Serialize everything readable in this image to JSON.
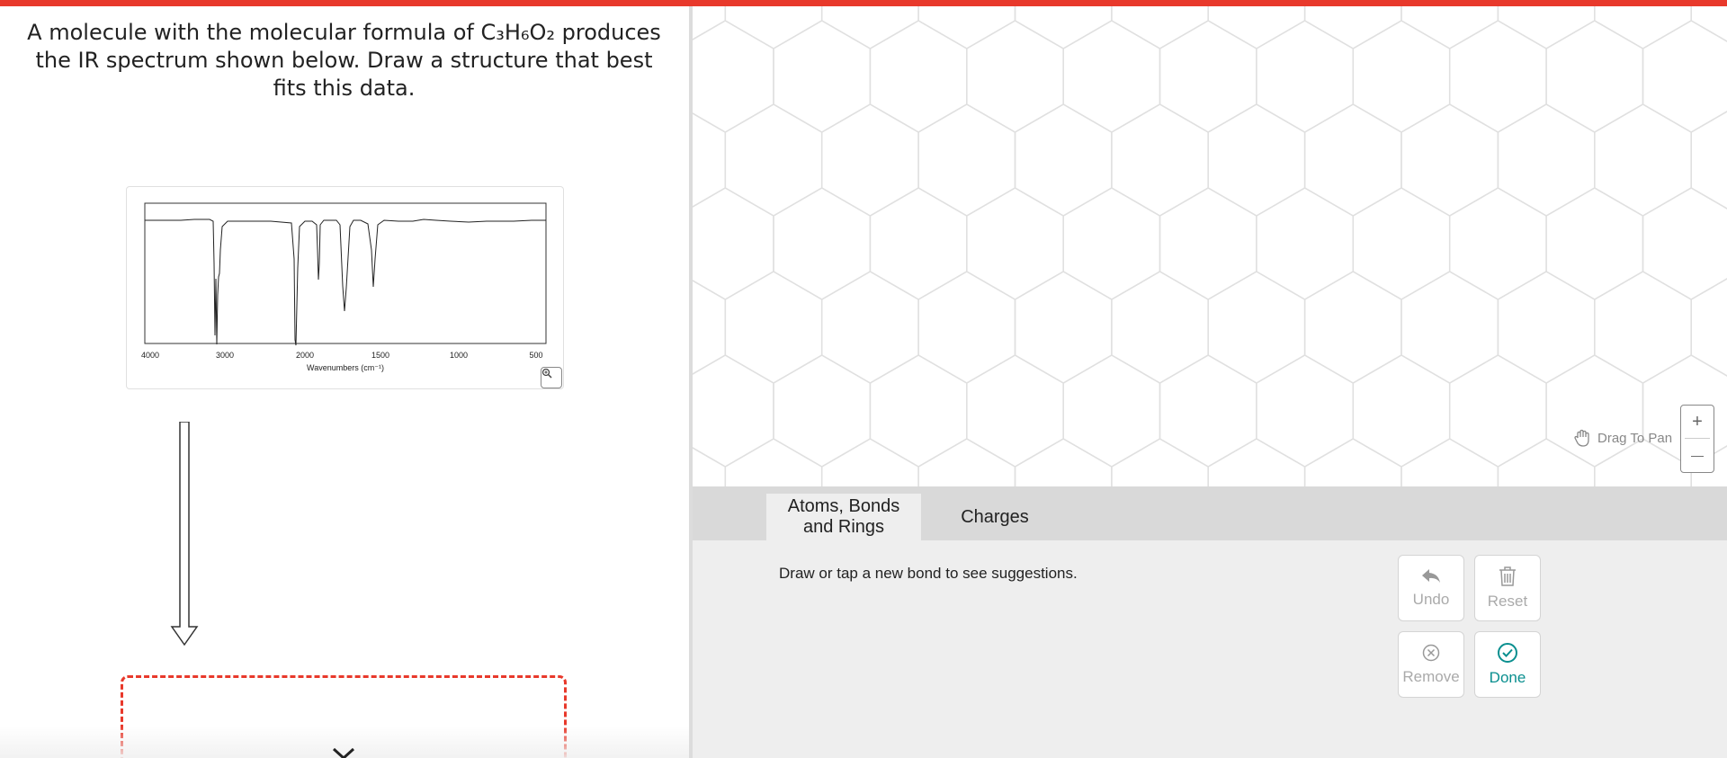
{
  "question": {
    "text": "A molecule with the molecular formula of C₃H₆O₂ produces the IR spectrum shown below. Draw a structure that best fits this data."
  },
  "spectrum": {
    "x_ticks": [
      "4000",
      "3000",
      "2000",
      "1500",
      "1000",
      "500"
    ],
    "x_label": "Wavenumbers (cm⁻¹)"
  },
  "canvas": {
    "pan_label": "Drag To Pan",
    "zoom_in": "+",
    "zoom_out": "—"
  },
  "tabs": [
    {
      "line1": "Atoms, Bonds",
      "line2": "and Rings",
      "active": true
    },
    {
      "line1": "Charges",
      "line2": "",
      "active": false
    }
  ],
  "panel": {
    "hint": "Draw or tap a new bond to see suggestions.",
    "undo": "Undo",
    "reset": "Reset",
    "remove": "Remove",
    "done": "Done"
  },
  "colors": {
    "accent_red": "#e8392b",
    "done_teal": "#0a8f8f",
    "hex_grid": "#e0e0e0"
  },
  "icons": [
    "zoom-icon",
    "down-arrow-icon",
    "chevron-down-icon",
    "hand-icon",
    "undo-icon",
    "trash-icon",
    "remove-icon",
    "done-check-icon"
  ]
}
